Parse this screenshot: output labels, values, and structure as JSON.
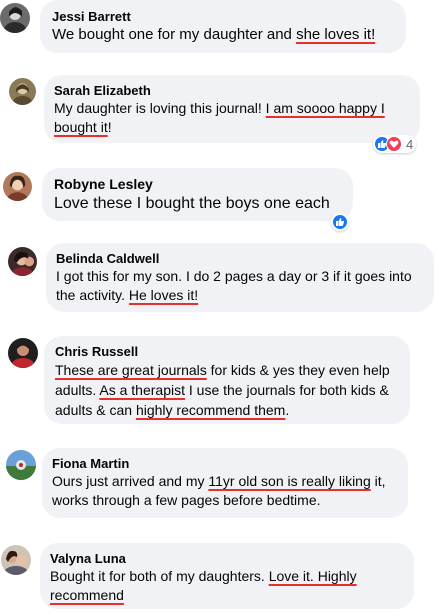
{
  "comments": [
    {
      "name": "Jessi Barrett",
      "parts": [
        "We bought one for my daughter and ",
        "she loves it!",
        ""
      ]
    },
    {
      "name": "Sarah Elizabeth",
      "parts": [
        "My daughter is loving this journal! ",
        "I am soooo happy I",
        " ",
        "bought it",
        "!"
      ],
      "reactions": {
        "icons": [
          "like-icon",
          "love-icon"
        ],
        "count": "4"
      }
    },
    {
      "name": "Robyne Lesley",
      "parts": [
        "Love these I bought the boys one each"
      ],
      "reactions": {
        "icons": [
          "like-icon"
        ]
      }
    },
    {
      "name": "Belinda Caldwell",
      "parts": [
        "I got this for my son. I do 2 pages a day or 3 if it goes into the activity. ",
        "He loves it!"
      ]
    },
    {
      "name": "Chris Russell",
      "parts": [
        "These are great journals",
        " for kids & yes they even help adults. ",
        "As a therapist",
        " I use the journals for both kids & adults & can ",
        "highly recommend them",
        "."
      ]
    },
    {
      "name": "Fiona Martin",
      "parts": [
        "Ours just arrived and my ",
        "11yr old son is really liking",
        " it, works through a few pages before bedtime."
      ]
    },
    {
      "name": "Valyna Luna",
      "parts": [
        "Bought it for both of my daughters. ",
        "Love it. Highly recommend"
      ]
    }
  ],
  "colors": {
    "bubble": "#f0f2f5",
    "underline": "#e5302f",
    "like": "#1877f2",
    "love": "#f33e58"
  }
}
